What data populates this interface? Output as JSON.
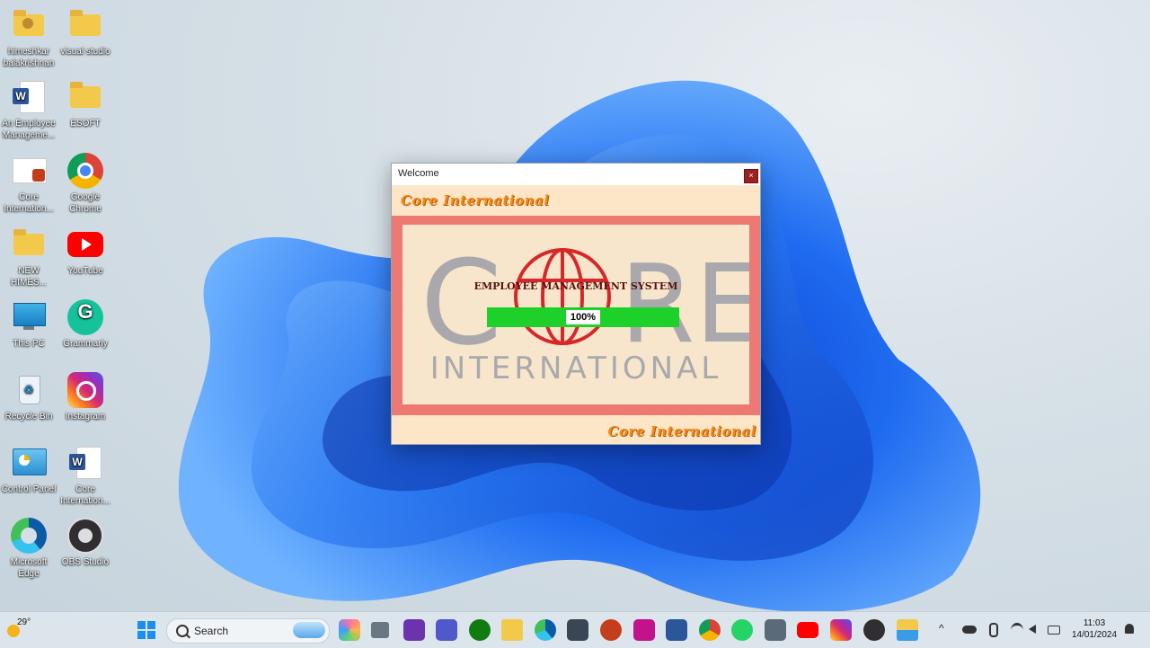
{
  "desktop": {
    "icons": [
      {
        "label": "himeshkar balakrishnan",
        "icon": "user-folder-icon"
      },
      {
        "label": "visual studio",
        "icon": "folder-icon"
      },
      {
        "label": "An Employee Manageme...",
        "icon": "word-document-icon"
      },
      {
        "label": "ESOFT",
        "icon": "folder-icon"
      },
      {
        "label": "Core Internation...",
        "icon": "powerpoint-document-icon"
      },
      {
        "label": "Google Chrome",
        "icon": "chrome-icon"
      },
      {
        "label": "NEW HIMES...",
        "icon": "folder-icon"
      },
      {
        "label": "YouTube",
        "icon": "youtube-icon"
      },
      {
        "label": "This PC",
        "icon": "monitor-icon"
      },
      {
        "label": "Grammarly",
        "icon": "grammarly-icon"
      },
      {
        "label": "Recycle Bin",
        "icon": "recycle-bin-icon"
      },
      {
        "label": "Instagram",
        "icon": "instagram-icon"
      },
      {
        "label": "Control Panel",
        "icon": "control-panel-icon"
      },
      {
        "label": "Core Internation...",
        "icon": "word-document-icon"
      },
      {
        "label": "Microsoft Edge",
        "icon": "edge-icon"
      },
      {
        "label": "OBS Studio",
        "icon": "obs-icon"
      }
    ]
  },
  "welcome_window": {
    "title": "Welcome",
    "close_glyph": "×",
    "brand_top": "Core International",
    "brand_bottom": "Core International",
    "logo": {
      "left_letter": "C",
      "right_letters": "RE",
      "subtitle": "INTERNATIONAL"
    },
    "system_title": "EMPLOYEE MANAGEMENT SYSTEM",
    "progress_value": 1.0,
    "progress_label": "100%",
    "colors": {
      "brand_orange": "#f08a14",
      "panel_red": "#ec7a72",
      "progress_green": "#1ed12a",
      "globe_red": "#d62828",
      "logo_grey": "#a9a9ad"
    }
  },
  "taskbar": {
    "weather_temp": "29°",
    "search_placeholder": "Search",
    "apps": [
      "windows-start-icon",
      "copilot-icon",
      "task-view-icon",
      "visual-studio-icon",
      "teams-icon",
      "xbox-icon",
      "file-explorer-icon",
      "edge-icon",
      "store-icon",
      "powerpoint-icon",
      "picsart-icon",
      "word-icon",
      "chrome-icon",
      "whatsapp-icon",
      "snipping-icon",
      "youtube-icon",
      "instagram-icon",
      "obs-icon",
      "app-window-icon"
    ],
    "time": "11:03",
    "date": "14/01/2024"
  }
}
